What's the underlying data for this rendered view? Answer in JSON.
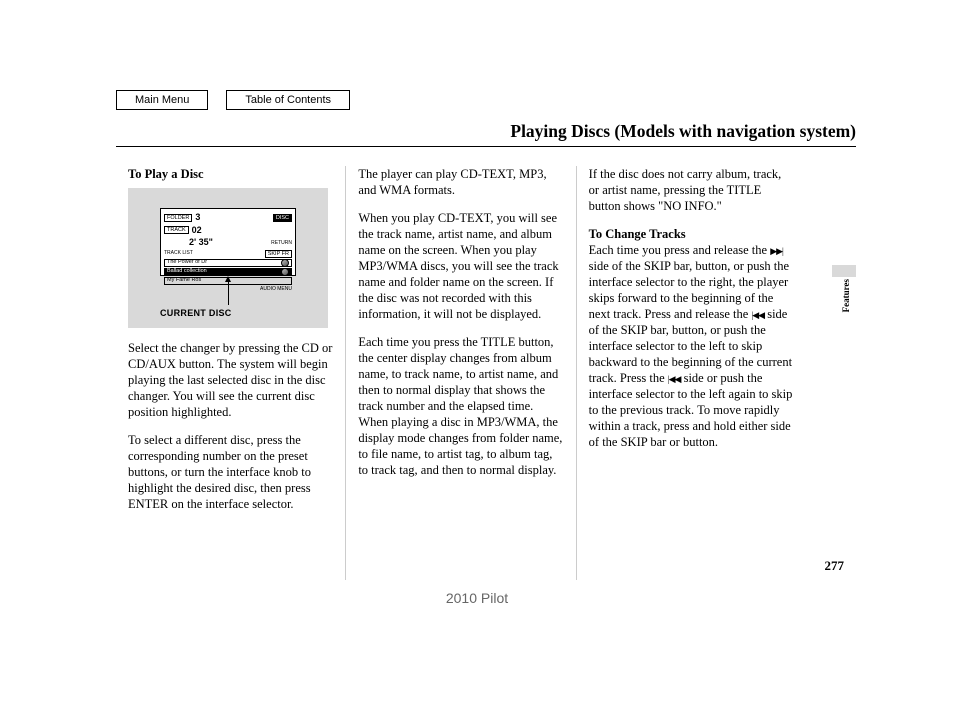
{
  "nav": {
    "main_menu": "Main Menu",
    "toc": "Table of Contents"
  },
  "title": "Playing Discs (Models with navigation system)",
  "side_tab": "Features",
  "page_number": "277",
  "footer": "2010 Pilot",
  "col1": {
    "heading": "To Play a Disc",
    "diagram": {
      "badge_folder": "FOLDER",
      "badge_track": "TRACK",
      "badge_disc": "DISC",
      "val_disc": "3",
      "val_track": "02",
      "val_time": "2' 35\"",
      "label_track_list": "TRACK LIST",
      "label_return": "RETURN",
      "btn_skip_fr": "SKIP FR",
      "song1": "The Power of Dr",
      "song2": "Ballad collection",
      "song3": "My Fame Ros",
      "audio_menu": "AUDIO MENU",
      "caption": "CURRENT DISC"
    },
    "p1": "Select the changer by pressing the CD or CD/AUX button. The system will begin playing the last selected disc in the disc changer. You will see the current disc position highlighted.",
    "p2": "To select a different disc, press the corresponding number on the preset buttons, or turn the interface knob to highlight the desired disc, then press ENTER on the interface selector."
  },
  "col2": {
    "p1": "The player can play CD-TEXT, MP3, and WMA formats.",
    "p2": "When you play CD-TEXT, you will see the track name, artist name, and album name on the screen. When you play MP3/WMA discs, you will see the track name and folder name on the screen. If the disc was not recorded with this information, it will not be displayed.",
    "p3": "Each time you press the TITLE button, the center display changes from album name, to track name, to artist name, and then to normal display that shows the track number and the elapsed time. When playing a disc in MP3/WMA, the display mode changes from folder name, to file name, to artist tag, to album tag, to track tag, and then to normal display."
  },
  "col3": {
    "p1": "If the disc does not carry album, track, or artist name, pressing the TITLE button shows \"NO INFO.\"",
    "heading2": "To Change Tracks",
    "p2a": "Each time you press and release the ",
    "p2b": " side of the SKIP bar, button, or push the interface selector to the right, the player skips forward to the beginning of the next track. Press and release the ",
    "p2c": " side of the SKIP bar, button, or push the interface selector to the left to skip backward to the beginning of the current track. Press the ",
    "p2d": " side or push the interface selector to the left again to skip to the previous track. To move rapidly within a track, press and hold either side of the SKIP bar or button."
  }
}
